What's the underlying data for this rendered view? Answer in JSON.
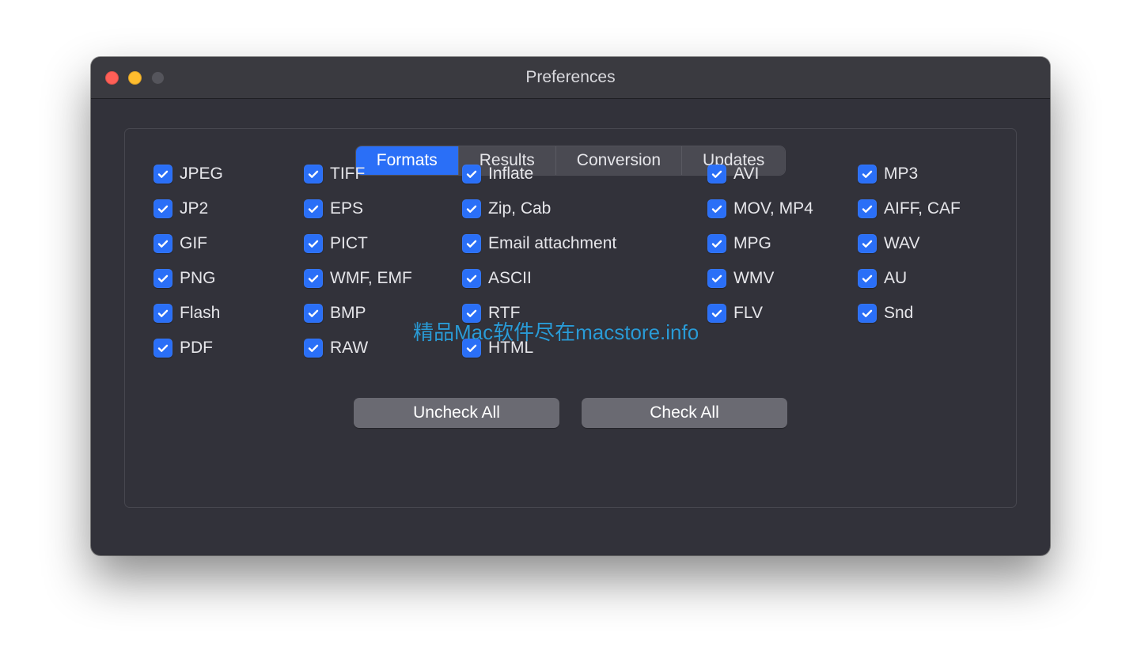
{
  "window": {
    "title": "Preferences"
  },
  "tabs": [
    {
      "label": "Formats",
      "active": true
    },
    {
      "label": "Results",
      "active": false
    },
    {
      "label": "Conversion",
      "active": false
    },
    {
      "label": "Updates",
      "active": false
    }
  ],
  "columns": [
    [
      "JPEG",
      "JP2",
      "GIF",
      "PNG",
      "Flash",
      "PDF"
    ],
    [
      "TIFF",
      "EPS",
      "PICT",
      "WMF, EMF",
      "BMP",
      "RAW"
    ],
    [
      "Inflate",
      "Zip, Cab",
      "Email attachment",
      "ASCII",
      "RTF",
      "HTML"
    ],
    [
      "AVI",
      "MOV, MP4",
      "MPG",
      "WMV",
      "FLV"
    ],
    [
      "MP3",
      "AIFF, CAF",
      "WAV",
      "AU",
      "Snd"
    ]
  ],
  "buttons": {
    "uncheck_all": "Uncheck All",
    "check_all": "Check All"
  },
  "watermark": "精品Mac软件尽在macstore.info"
}
